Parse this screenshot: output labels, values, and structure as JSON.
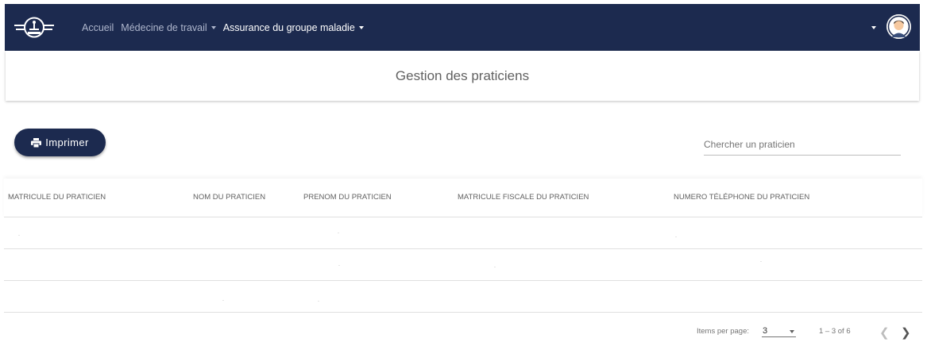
{
  "header": {
    "nav": [
      {
        "label": "Accueil",
        "has_caret": false,
        "active": false
      },
      {
        "label": "Médecine de travail",
        "has_caret": true,
        "active": false
      },
      {
        "label": "Assurance du groupe maladie",
        "has_caret": true,
        "active": true
      }
    ],
    "icons": {
      "logo": "organization-logo",
      "user_menu": "chevron-down-icon",
      "avatar": "user-avatar"
    }
  },
  "page": {
    "title": "Gestion des praticiens"
  },
  "toolbar": {
    "print_label": "Imprimer",
    "print_icon": "printer-icon",
    "search_placeholder": "Chercher un praticien"
  },
  "table": {
    "columns": [
      "MATRICULE DU PRATICIEN",
      "NOM DU PRATICIEN",
      "PRENOM DU PRATICIEN",
      "MATRICULE FISCALE DU PRATICIEN",
      "NUMERO TÉLÉPHONE DU PRATICIEN"
    ],
    "rows": [
      [
        "",
        "",
        "",
        "",
        ""
      ],
      [
        "",
        "",
        "",
        "",
        ""
      ],
      [
        "",
        "",
        "",
        "",
        ""
      ]
    ]
  },
  "paginator": {
    "items_per_page_label": "Items per page:",
    "page_size": "3",
    "range_label": "1 – 3 of 6"
  },
  "colors": {
    "navbar": "#1c2a4f",
    "primary_button": "#1c2a4f",
    "title_text": "#616161",
    "header_text": "#616161"
  }
}
